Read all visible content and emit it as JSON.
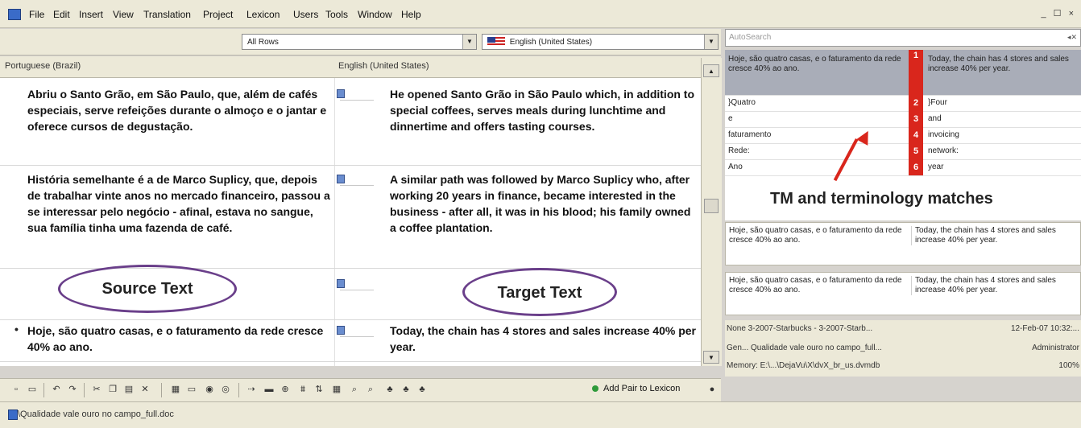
{
  "menubar": {
    "items": [
      "File",
      "Edit",
      "Insert",
      "View",
      "Translation",
      "Project",
      "Lexicon",
      "Users",
      "Tools",
      "Window",
      "Help"
    ],
    "window_controls": "_ ☐ ×"
  },
  "filter": {
    "rows_value": "All Rows",
    "language_value": "English (United States)"
  },
  "columns": {
    "source_header": "Portuguese (Brazil)",
    "target_header": "English (United States)"
  },
  "rows": [
    {
      "source": "Abriu o Santo Grão, em São Paulo, que, além de cafés especiais, serve refeições durante o almoço e o jantar e oferece cursos de degustação.",
      "target": "He opened Santo Grão in São Paulo which, in addition to special coffees, serves meals during lunchtime and dinnertime and offers tasting courses."
    },
    {
      "source": "História semelhante é a de Marco Suplicy, que, depois de trabalhar vinte anos no mercado financeiro, passou a se interessar pelo negócio - afinal, estava no sangue, sua família tinha uma fazenda de café.",
      "target": "A similar path was followed by Marco Suplicy who, after working 20 years in finance, became interested in the business - after all, it was in his blood; his family owned a coffee plantation."
    },
    {
      "source": "",
      "target": ""
    },
    {
      "marker": "•",
      "source": "Hoje, são quatro casas, e o faturamento da rede cresce 40% ao ano.",
      "target": "Today, the chain has 4 stores and sales increase 40% per year."
    }
  ],
  "annotations": {
    "source_label": "Source Text",
    "target_label": "Target Text",
    "tm_label": "TM and terminology matches"
  },
  "toolbar": {
    "add_pair_label": "Add Pair to Lexicon"
  },
  "status": {
    "file": "\\Qualidade vale ouro no campo_full.doc"
  },
  "right": {
    "autosearch_placeholder": "AutoSearch",
    "tm_matches": [
      {
        "num": "1",
        "source": "Hoje, são quatro casas, e o faturamento da rede cresce 40% ao ano.",
        "target": "Today, the chain has 4 stores and sales increase 40% per year."
      },
      {
        "num": "2",
        "source": "}Quatro",
        "target": "}Four"
      },
      {
        "num": "3",
        "source": "e",
        "target": "and"
      },
      {
        "num": "4",
        "source": "faturamento",
        "target": "invoicing"
      },
      {
        "num": "5",
        "source": "Rede:",
        "target": "network:"
      },
      {
        "num": "6",
        "source": "Ano",
        "target": "year"
      }
    ],
    "concordance": [
      {
        "source": "Hoje, são quatro casas, e o faturamento da rede cresce 40% ao ano.",
        "target": "Today, the chain has 4 stores and sales increase 40% per year."
      },
      {
        "source": "Hoje, são quatro casas, e o faturamento da rede cresce 40% ao ano.",
        "target": "Today, the chain has 4 stores and sales increase 40% per year."
      }
    ],
    "info": [
      {
        "left": "None  3-2007-Starbucks - 3-2007-Starb...",
        "right": "12-Feb-07 10:32:..."
      },
      {
        "left": "Gen...  Qualidade vale ouro no campo_full...",
        "right": "Administrator"
      },
      {
        "left": "Memory: E:\\...\\DejaVu\\X\\dvX_br_us.dvmdb",
        "right": "100%"
      }
    ]
  },
  "colors": {
    "accent_red": "#d9261c",
    "oval": "#6a3f8a",
    "chrome": "#ece9d8"
  }
}
